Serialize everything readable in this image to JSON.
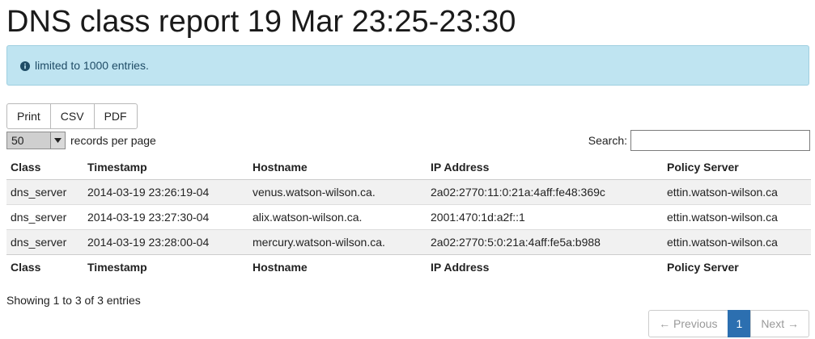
{
  "page_title": "DNS class report 19 Mar 23:25-23:30",
  "alert": {
    "icon": "info-icon",
    "text": "limited to 1000 entries."
  },
  "export_buttons": {
    "print": "Print",
    "csv": "CSV",
    "pdf": "PDF"
  },
  "length": {
    "value": "50",
    "suffix": "records per page"
  },
  "search": {
    "label": "Search:",
    "value": "",
    "placeholder": ""
  },
  "table": {
    "headers": [
      "Class",
      "Timestamp",
      "Hostname",
      "IP Address",
      "Policy Server"
    ],
    "rows": [
      [
        "dns_server",
        "2014-03-19 23:26:19-04",
        "venus.watson-wilson.ca.",
        "2a02:2770:11:0:21a:4aff:fe48:369c",
        "ettin.watson-wilson.ca"
      ],
      [
        "dns_server",
        "2014-03-19 23:27:30-04",
        "alix.watson-wilson.ca.",
        "2001:470:1d:a2f::1",
        "ettin.watson-wilson.ca"
      ],
      [
        "dns_server",
        "2014-03-19 23:28:00-04",
        "mercury.watson-wilson.ca.",
        "2a02:2770:5:0:21a:4aff:fe5a:b988",
        "ettin.watson-wilson.ca"
      ]
    ]
  },
  "info": "Showing 1 to 3 of 3 entries",
  "pagination": {
    "previous": "← Previous",
    "current": "1",
    "next": "Next →"
  },
  "colors": {
    "alert_bg": "#bfe4f1",
    "active_page": "#2c6fb0"
  }
}
